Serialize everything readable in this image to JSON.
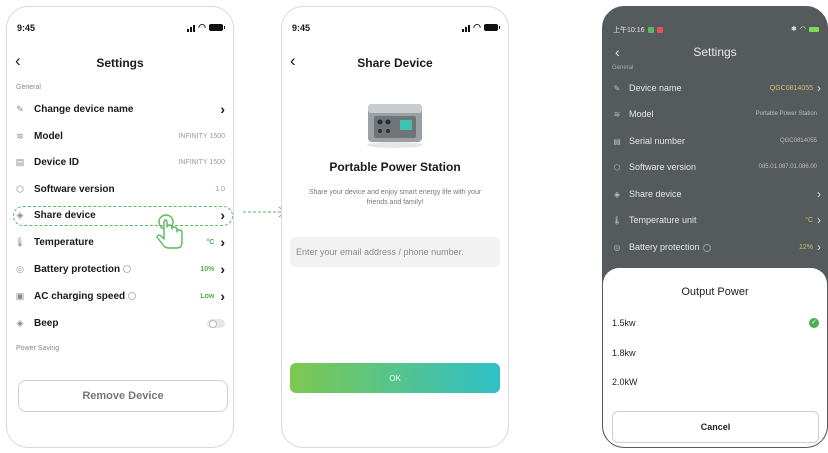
{
  "screen1": {
    "status_time": "9:45",
    "back_icon": "chevron-left-icon",
    "title": "Settings",
    "general_label": "General",
    "rows": [
      {
        "icon": "pencil-icon",
        "label": "Change device name",
        "value": ""
      },
      {
        "icon": "stack-icon",
        "label": "Model",
        "value": "INFINITY 1500"
      },
      {
        "icon": "id-card-icon",
        "label": "Device ID",
        "value": "INFINITY 1500"
      },
      {
        "icon": "cube-icon",
        "label": "Software version",
        "value": "1.0"
      },
      {
        "icon": "share-icon",
        "label": "Share device",
        "value": ""
      },
      {
        "icon": "thermometer-icon",
        "label": "Temperature",
        "value": "°C"
      },
      {
        "icon": "shield-icon",
        "label": "Battery protection",
        "value": "10%"
      },
      {
        "icon": "charger-icon",
        "label": "AC charging speed",
        "value": "Low"
      },
      {
        "icon": "beep-icon",
        "label": "Beep",
        "value": ""
      }
    ],
    "power_saving_label": "Power Saving",
    "remove_label": "Remove Device",
    "accent_color": "#5cb85c"
  },
  "screen2": {
    "status_time": "9:45",
    "title": "Share Device",
    "product_title": "Portable Power Station",
    "description": "Share your device and enjoy smart energy life with your friends and family!",
    "email_placeholder": "Enter your email address / phone number.",
    "ok_label": "OK",
    "gradient_colors": [
      "#7ec850",
      "#2ec0c8"
    ]
  },
  "screen3": {
    "status_time": "上午10:16",
    "title": "Settings",
    "general_label": "General",
    "rows": [
      {
        "icon": "pencil-icon",
        "label": "Device name",
        "value": "QGC0814055"
      },
      {
        "icon": "stack-icon",
        "label": "Model",
        "value": "Portable Power Station"
      },
      {
        "icon": "id-card-icon",
        "label": "Serial number",
        "value": "QGC0814055"
      },
      {
        "icon": "cube-icon",
        "label": "Software version",
        "value": "085.01.087.01.086.00"
      },
      {
        "icon": "share-icon",
        "label": "Share device",
        "value": ""
      },
      {
        "icon": "thermometer-icon",
        "label": "Temperature unit",
        "value": "°C"
      },
      {
        "icon": "shield-icon",
        "label": "Battery protection",
        "value": "12%"
      }
    ],
    "sheet_title": "Output Power",
    "options": [
      "1.5kw",
      "1.8kw",
      "2.0kW"
    ],
    "selected_option": "1.5kw",
    "cancel_label": "Cancel"
  }
}
